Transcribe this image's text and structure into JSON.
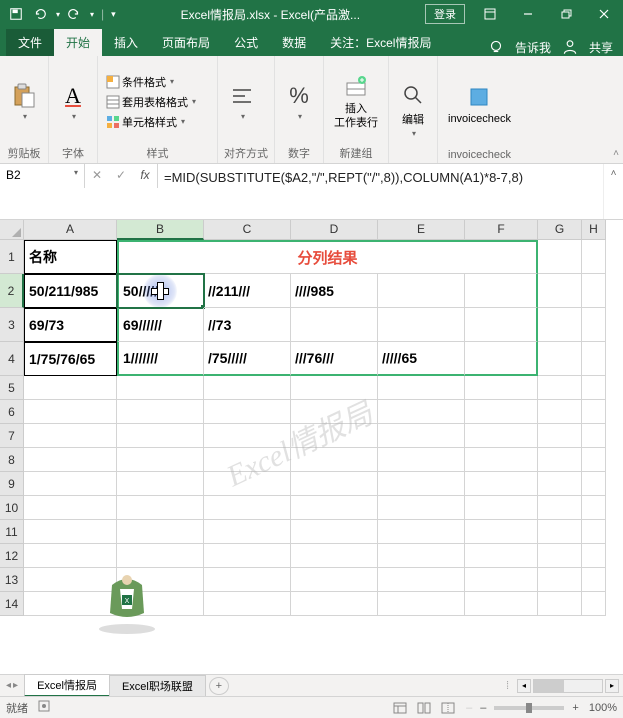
{
  "titlebar": {
    "filename": "Excel情报局.xlsx",
    "app_suffix": " - Excel(产品激...",
    "login": "登录"
  },
  "tabs": {
    "file": "文件",
    "home": "开始",
    "insert": "插入",
    "layout": "页面布局",
    "formulas": "公式",
    "data": "数据",
    "focus": "关注：Excel情报局",
    "tellme": "告诉我",
    "share": "共享"
  },
  "ribbon": {
    "clipboard": {
      "label": "剪贴板",
      "paste": ""
    },
    "font": {
      "label": "字体",
      "btn": "A"
    },
    "styles": {
      "label": "样式",
      "cond_format": "条件格式",
      "table_format": "套用表格格式",
      "cell_styles": "单元格样式"
    },
    "align": {
      "label": "对齐方式"
    },
    "number": {
      "label": "数字",
      "percent": "%"
    },
    "cells": {
      "label": "新建组",
      "insert": "插入\n工作表行"
    },
    "editing": {
      "label": "",
      "edit": "编辑"
    },
    "addin": {
      "label": "invoicecheck",
      "btn": "invoicecheck"
    }
  },
  "namebox": {
    "ref": "B2"
  },
  "formula": "=MID(SUBSTITUTE($A2,\"/\",REPT(\"/\",8)),COLUMN(A1)*8-7,8)",
  "cols": [
    "A",
    "B",
    "C",
    "D",
    "E",
    "F",
    "G",
    "H"
  ],
  "rows": [
    "1",
    "2",
    "3",
    "4",
    "5",
    "6",
    "7",
    "8",
    "9",
    "10",
    "11",
    "12",
    "13",
    "14"
  ],
  "cells": {
    "A1": "名称",
    "BF1": "分列结果",
    "A2": "50/211/985",
    "B2": "50//////",
    "C2": "//211///",
    "D2": "////985",
    "A3": "69/73",
    "B3": "69//////",
    "C3": "//73",
    "A4": "1/75/76/65",
    "B4": "1///////",
    "C4": "/75/////",
    "D4": "///76///",
    "E4": "/////65"
  },
  "watermark": "Excel情报局",
  "sheets": {
    "active": "Excel情报局",
    "inactive": "Excel职场联盟"
  },
  "status": {
    "ready": "就绪",
    "zoom": "100%"
  }
}
